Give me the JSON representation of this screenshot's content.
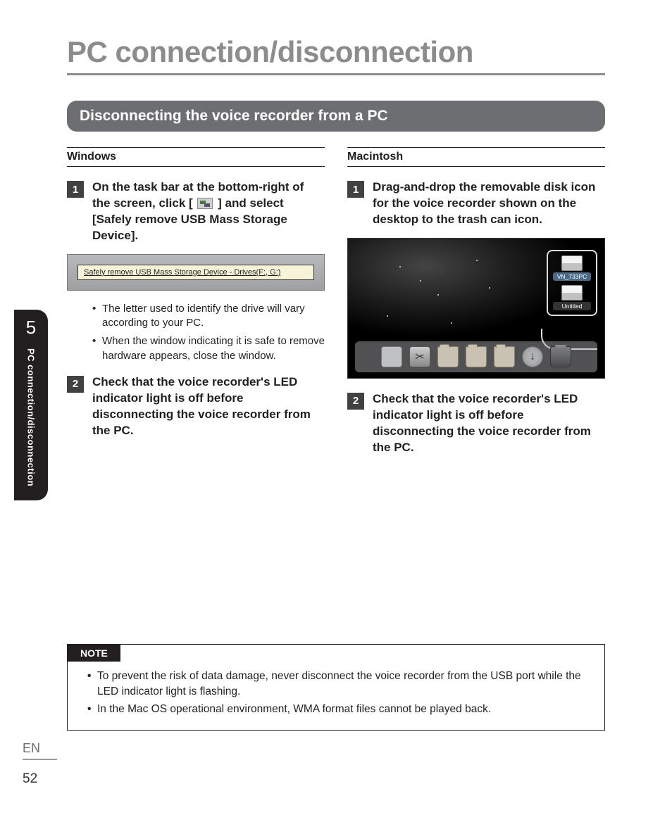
{
  "page_title": "PC connection/disconnection",
  "section_heading": "Disconnecting the voice recorder from a PC",
  "sidebar": {
    "chapter_number": "5",
    "chapter_title": "PC connection/disconnection"
  },
  "windows": {
    "label": "Windows",
    "step1": {
      "num": "1",
      "pre": "On the task bar at the bottom-right of the screen, click [",
      "post": "] and select [",
      "bold": "Safely remove USB Mass Storage Device",
      "end": "]."
    },
    "popup_text": "Safely remove USB Mass Storage Device - Drives(F:, G:)",
    "bullets": [
      "The letter used to identify the drive will vary according to your PC.",
      "When the window indicating it is safe to remove hardware appears, close the window."
    ],
    "step2": {
      "num": "2",
      "text": "Check that the voice recorder's LED indicator light is off before disconnecting the voice recorder from the PC."
    }
  },
  "mac": {
    "label": "Macintosh",
    "step1": {
      "num": "1",
      "text": "Drag-and-drop the removable disk icon for the voice recorder shown on the desktop to the trash can icon."
    },
    "drives": {
      "a": "VN_733PC",
      "b": "Untitled"
    },
    "step2": {
      "num": "2",
      "text": "Check that the voice recorder's LED indicator light is off before disconnecting the voice recorder from the PC."
    }
  },
  "note": {
    "label": "NOTE",
    "items": [
      "To prevent the risk of data damage, never disconnect the voice recorder from the USB port while the LED indicator light is flashing.",
      "In the Mac OS operational environment, WMA format files cannot be played back."
    ]
  },
  "footer": {
    "lang": "EN",
    "page": "52"
  }
}
